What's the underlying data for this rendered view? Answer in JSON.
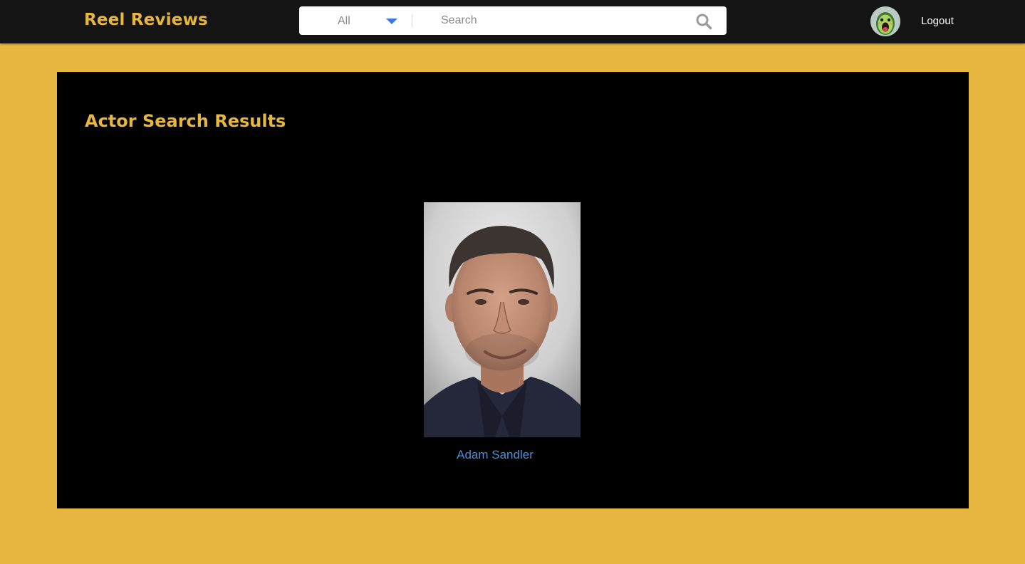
{
  "nav": {
    "brand": "Reel Reviews",
    "search": {
      "filter_value": "All",
      "placeholder": "Search"
    },
    "avatar_icon": "avocado-avatar-icon",
    "logout_label": "Logout"
  },
  "colors": {
    "accent": "#e6b63e",
    "nav_background": "#141414",
    "panel_background": "#000000",
    "link": "#4a90d9",
    "caret": "#3b78e7"
  },
  "main": {
    "title": "Actor Search Results",
    "results": [
      {
        "name": "Adam Sandler",
        "photo_icon": "actor-photo"
      }
    ]
  }
}
